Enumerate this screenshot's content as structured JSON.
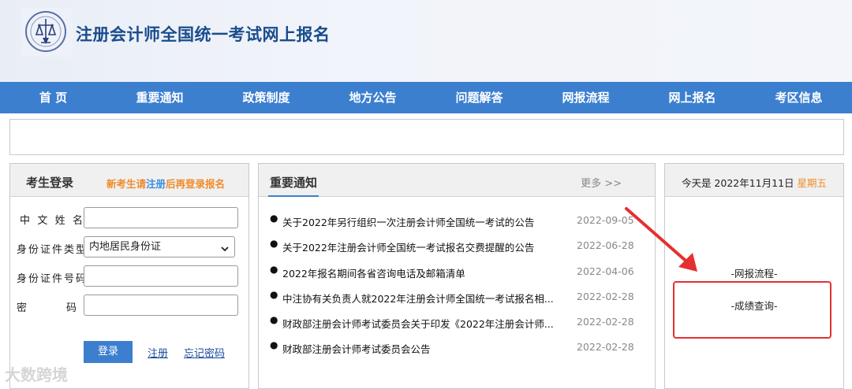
{
  "header": {
    "site_title": "注册会计师全国统一考试网上报名",
    "logo_icon": "cicpa-seal-logo"
  },
  "nav": {
    "items": [
      "首 页",
      "重要通知",
      "政策制度",
      "地方公告",
      "问题解答",
      "网报流程",
      "网上报名",
      "考区信息"
    ]
  },
  "login": {
    "title": "考生登录",
    "hint_before": "新考生请",
    "hint_link": "注册",
    "hint_after": "后再登录报名",
    "fields": {
      "name_label": "中文姓名",
      "name_value": "",
      "idtype_label": "身份证件类型",
      "idtype_value": "内地居民身份证",
      "idnum_label": "身份证件号码",
      "idnum_value": "",
      "password_label": "密码",
      "password_value": ""
    },
    "login_button": "登录",
    "register_link": "注册",
    "forgot_link": "忘记密码"
  },
  "notice": {
    "title": "重要通知",
    "more": "更多 >>",
    "items": [
      {
        "title": "关于2022年另行组织一次注册会计师全国统一考试的公告",
        "date": "2022-09-05"
      },
      {
        "title": "关于2022年注册会计师全国统一考试报名交费提醒的公告",
        "date": "2022-06-28"
      },
      {
        "title": "2022年报名期间各省咨询电话及邮箱清单",
        "date": "2022-04-06"
      },
      {
        "title": "中注协有关负责人就2022年注册会计师全国统一考试报名相...",
        "date": "2022-02-28"
      },
      {
        "title": "财政部注册会计师考试委员会关于印发《2022年注册会计师...",
        "date": "2022-02-28"
      },
      {
        "title": "财政部注册会计师考试委员会公告",
        "date": "2022-02-28"
      }
    ]
  },
  "datepanel": {
    "date_prefix": "今天是 2022年11月11日",
    "weekday": "星期五",
    "link_process": "-网报流程-",
    "link_score": "-成绩查询-"
  },
  "annotation": {
    "highlight_color": "#e53030"
  },
  "watermark": "大数跨境"
}
